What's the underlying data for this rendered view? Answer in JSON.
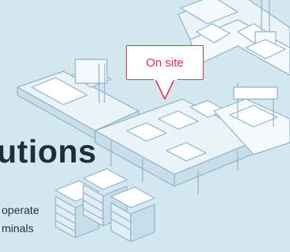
{
  "hero": {
    "headline": "utions",
    "body_lines": [
      "operate",
      "minals"
    ]
  },
  "callout": {
    "label": "On site",
    "accent_color": "#e2304f"
  },
  "illustration": {
    "background_color": "#d3e7f1",
    "line_color": "#8fb4c8"
  }
}
